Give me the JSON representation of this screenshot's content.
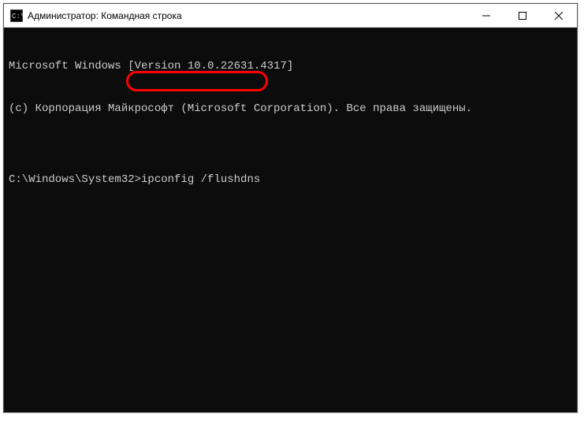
{
  "titlebar": {
    "title": "Администратор: Командная строка"
  },
  "terminal": {
    "line1": "Microsoft Windows [Version 10.0.22631.4317]",
    "line2": "(c) Корпорация Майкрософт (Microsoft Corporation). Все права защищены.",
    "blank": "",
    "prompt": "C:\\Windows\\System32>",
    "command": "ipconfig /flushdns"
  }
}
